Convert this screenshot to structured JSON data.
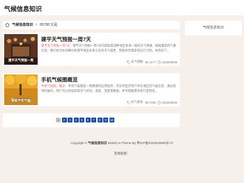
{
  "site": {
    "title": "气候信息知识"
  },
  "breadcrumb": {
    "home": "气候信息知识",
    "separator": ">",
    "current": "80788 又是"
  },
  "sidebar": {
    "label": "气候信息知识"
  },
  "articles": [
    {
      "title": "建平天气预报一周7天",
      "thumb_caption": "建平天气预报一周",
      "excerpt_highlight": "建平天气预报一周7天",
      "excerpt": "：建平天气预报一周7天的获取渠道种地区本来一般的天气预报、根据最新的气象信息，我们给为你详细分析建平地区未来七天的天气趋势，帮助你合理安排出行计划。本周天气...",
      "views_label": "天气预报",
      "views": "1177",
      "date": "2025/08/09"
    },
    {
      "title": "手机气候图概览",
      "thumb_caption": "智能手机气候",
      "excerpt_highlight": "手机气候图，概览",
      "excerpt": "：手机气候图是一款便捷的应用程序，可实时显示用户所在地区的气候信息、通过简单的操作，用户可以轻松获取天气状况、温度、湿度等数据，并可根据需求进行定制化...",
      "views_label": "天气查询",
      "views": "7006",
      "date": "2025/08/09"
    }
  ],
  "pagination": {
    "current": "1",
    "pages": [
      "2",
      "3",
      "4",
      "5",
      "6",
      "7",
      "8",
      "9",
      "10"
    ]
  },
  "footer": {
    "copyright_prefix": "Copyright ©",
    "site_name": "气候信息知识",
    "text": "94640.cn Theme By",
    "icp": "粤ICP备2023016990号-47"
  },
  "links": {
    "label": "友情链接："
  },
  "colors": {
    "accent": "#1c4f9c",
    "highlight": "#e06a6a",
    "background": "#f7efe9"
  }
}
